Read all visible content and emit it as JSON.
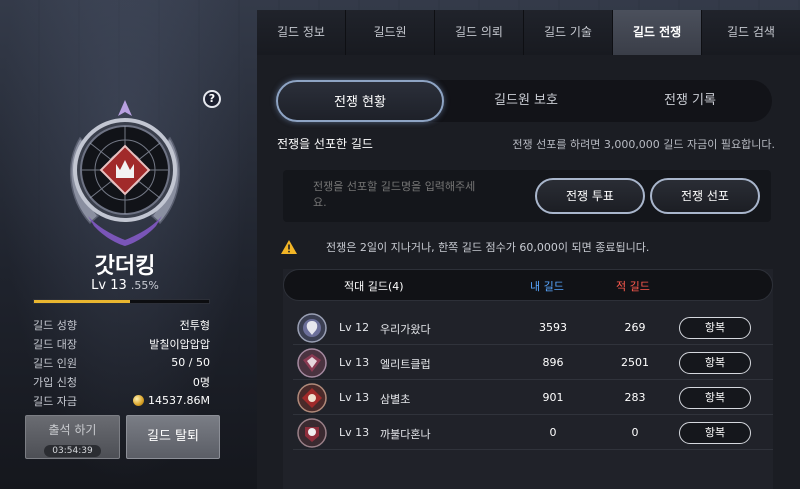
{
  "left_panel": {
    "help_label": "?",
    "guild_name": "갓더킹",
    "level_text": "Lv 13",
    "level_pct": ".55%",
    "xp_progress_percent": 55,
    "info": [
      {
        "key": "길드 성향",
        "value": "전투형"
      },
      {
        "key": "길드 대장",
        "value": "발칠이압압압"
      },
      {
        "key": "길드 인원",
        "value": "50 / 50"
      },
      {
        "key": "가입 신청",
        "value": "0명"
      },
      {
        "key": "길드 자금",
        "value": "14537.86M"
      }
    ],
    "attend_button": {
      "label": "출석 하기",
      "timer": "03:54:39"
    },
    "leave_button": "길드 탈퇴"
  },
  "tabs": [
    "길드 정보",
    "길드원",
    "길드 의뢰",
    "길드 기술",
    "길드 전쟁",
    "길드 검색"
  ],
  "active_tab_index": 4,
  "subtabs": [
    "전쟁 현황",
    "길드원 보호",
    "전쟁 기록"
  ],
  "active_subtab_index": 0,
  "section": {
    "title": "전쟁을 선포한 길드",
    "note": "전쟁 선포를 하려면 3,000,000 길드 자금이 필요합니다."
  },
  "declare": {
    "placeholder": "전쟁을 선포할 길드명을 입력해주세요.",
    "vote_button": "전쟁 투표",
    "declare_button": "전쟁 선포"
  },
  "warning_text": "전쟁은 2일이 지나거나, 한쪽 길드 점수가 60,000이 되면 종료됩니다.",
  "war_table": {
    "header_enemy": "적대 길드(4)",
    "header_mine": "내 길드",
    "header_opp": "적 길드",
    "rows": [
      {
        "level": "Lv 12",
        "name": "우리가왔다",
        "my_score": "3593",
        "enemy_score": "269",
        "action": "항복"
      },
      {
        "level": "Lv 13",
        "name": "엘리트클럽",
        "my_score": "896",
        "enemy_score": "2501",
        "action": "항복"
      },
      {
        "level": "Lv 13",
        "name": "삼별초",
        "my_score": "901",
        "enemy_score": "283",
        "action": "항복"
      },
      {
        "level": "Lv 13",
        "name": "까불다혼나",
        "my_score": "0",
        "enemy_score": "0",
        "action": "항복"
      }
    ]
  },
  "colors": {
    "xp_fill": "#e9b630",
    "my_guild": "#58a6ff",
    "enemy_guild": "#ff5a4e",
    "emblem_red": "#a12a2a"
  }
}
